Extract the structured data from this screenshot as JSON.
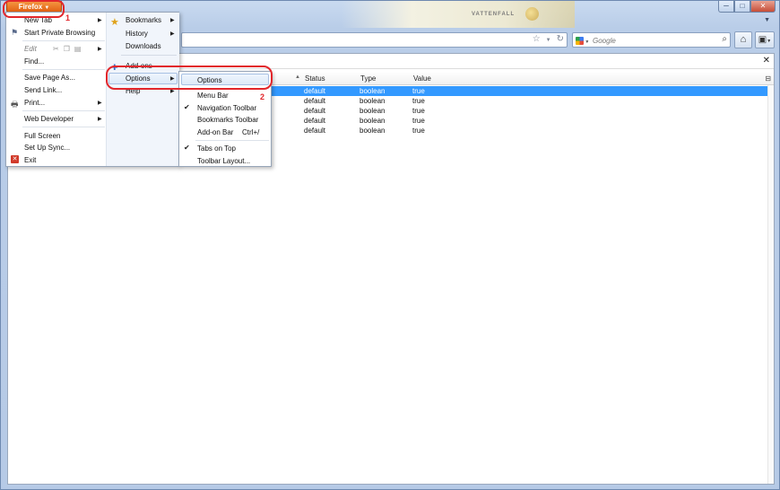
{
  "window": {
    "firefox_button": "Firefox",
    "brand_text": "VATTENFALL",
    "controls": [
      "─",
      "□",
      "✕"
    ]
  },
  "search": {
    "engine": "Google",
    "placeholder": "Google"
  },
  "annotations": {
    "one": "1",
    "two": "2"
  },
  "main_menu": {
    "left": {
      "new_tab": "New Tab",
      "private": "Start Private Browsing",
      "edit": "Edit",
      "find": "Find...",
      "save_page": "Save Page As...",
      "send_link": "Send Link...",
      "print": "Print...",
      "web_developer": "Web Developer",
      "full_screen": "Full Screen",
      "set_up_sync": "Set Up Sync...",
      "exit": "Exit"
    },
    "right": {
      "bookmarks": "Bookmarks",
      "history": "History",
      "downloads": "Downloads",
      "addons": "Add-ons",
      "options": "Options",
      "help": "Help"
    }
  },
  "options_submenu": {
    "options": "Options",
    "menu_bar": "Menu Bar",
    "navigation_toolbar": "Navigation Toolbar",
    "bookmarks_toolbar": "Bookmarks Toolbar",
    "addon_bar": "Add-on Bar",
    "addon_bar_shortcut": "Ctrl+/",
    "tabs_on_top": "Tabs on Top",
    "toolbar_layout": "Toolbar Layout..."
  },
  "table": {
    "headers": {
      "status": "Status",
      "type": "Type",
      "value": "Value"
    },
    "rows": [
      {
        "status": "default",
        "type": "boolean",
        "value": "true"
      },
      {
        "status": "default",
        "type": "boolean",
        "value": "true"
      },
      {
        "status": "default",
        "type": "boolean",
        "value": "true"
      },
      {
        "status": "default",
        "type": "boolean",
        "value": "true"
      },
      {
        "status": "default",
        "type": "boolean",
        "value": "true"
      }
    ]
  },
  "colors": {
    "accent": "#e15d0f",
    "selection": "#3399ff",
    "annotation": "#e2262b"
  }
}
